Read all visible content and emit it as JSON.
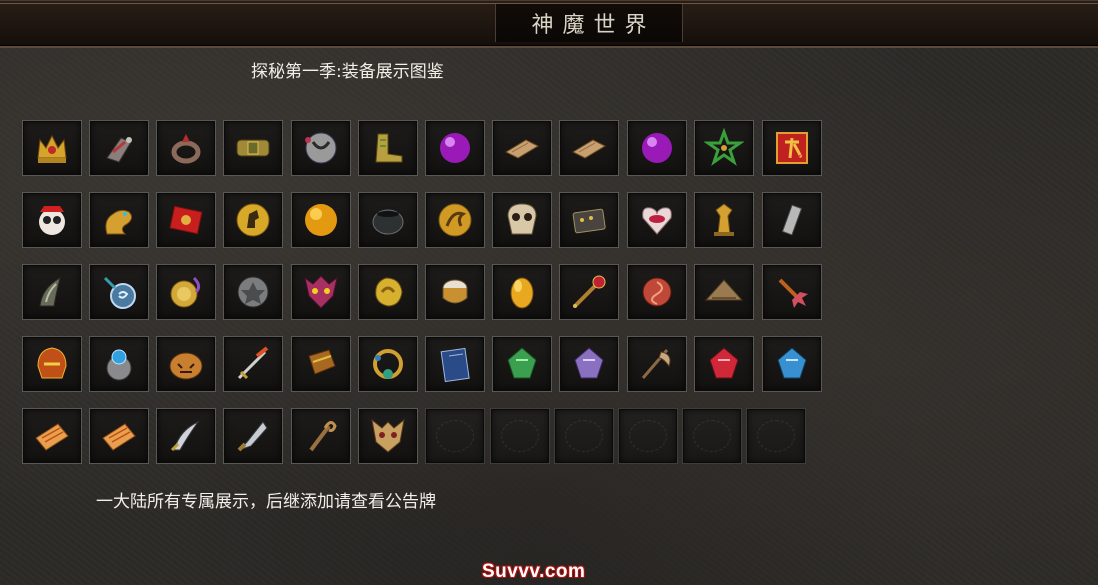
{
  "window": {
    "title": "神魔世界"
  },
  "header": {
    "subtitle": "探秘第一季:装备展示图鉴"
  },
  "footer": {
    "note": "一大陆所有专属展示，后继添加请查看公告牌"
  },
  "watermark": "Suvvv.com",
  "grid": {
    "rows": [
      [
        "crown-icon",
        "gauntlet-icon",
        "ring-icon",
        "belt-icon",
        "orb-stone-icon",
        "boots-icon",
        "purple-gem-icon",
        "scroll-tablet-icon",
        "scroll-tablet-icon",
        "purple-gem-icon",
        "star-badge-icon",
        "nine-seal-icon"
      ],
      [
        "panda-icon",
        "gold-dragon-icon",
        "red-envelope-icon",
        "gold-horse-coin-icon",
        "gold-orb-icon",
        "cauldron-icon",
        "gold-dragon-coin-icon",
        "skull-mask-icon",
        "device-icon",
        "heart-lips-icon",
        "gold-statue-icon",
        "stone-pillar-icon"
      ],
      [
        "claw-icon",
        "blue-amulet-icon",
        "gold-medallion-icon",
        "stone-disc-icon",
        "demon-mask-icon",
        "gold-nugget-icon",
        "drum-icon",
        "golden-egg-icon",
        "scepter-icon",
        "rose-gem-icon",
        "straw-hat-icon",
        "spiked-mace-icon"
      ],
      [
        "fire-helmet-icon",
        "sapphire-ring-icon",
        "pumpkin-icon",
        "flame-sword-icon",
        "bracer-icon",
        "jade-necklace-icon",
        "blue-book-icon",
        "green-gem-icon",
        "violet-gem-icon",
        "axe-icon",
        "red-gem-icon",
        "blue-gem-icon"
      ],
      [
        "paper-scroll-icon",
        "paper-scroll-icon",
        "curved-blade-icon",
        "broad-blade-icon",
        "staff-icon",
        "horned-mask-icon",
        "empty",
        "empty",
        "empty",
        "empty",
        "empty",
        "empty"
      ]
    ]
  },
  "colors": {
    "title_text": "#d9d3c6",
    "body_text": "#f2efe8",
    "watermark_outline": "#b01010",
    "slot_border": "#5a5854"
  }
}
